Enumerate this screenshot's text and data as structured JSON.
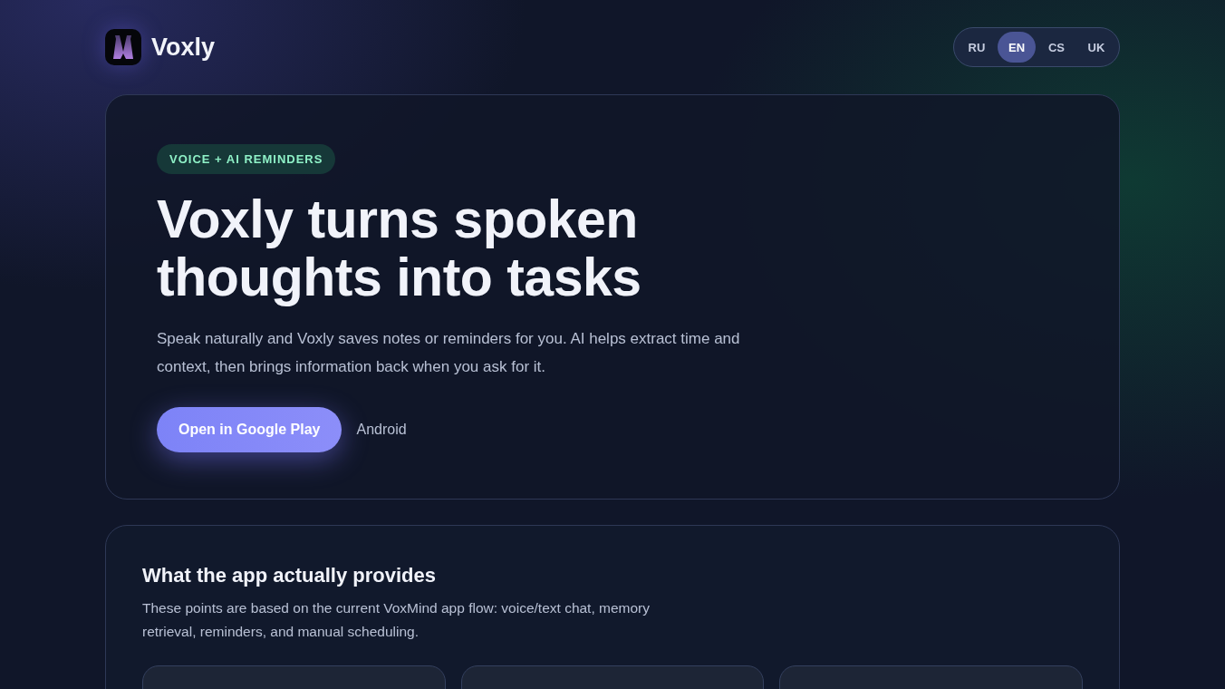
{
  "brand": {
    "name": "Voxly"
  },
  "languages": [
    {
      "label": "RU",
      "selected": false
    },
    {
      "label": "EN",
      "selected": true
    },
    {
      "label": "CS",
      "selected": false
    },
    {
      "label": "UK",
      "selected": false
    }
  ],
  "hero": {
    "badge": "VOICE + AI REMINDERS",
    "title": "Voxly turns spoken thoughts into tasks",
    "description": "Speak naturally and Voxly saves notes or reminders for you. AI helps extract time and context, then brings information back when you ask for it.",
    "button": "Open in Google Play",
    "platform": "Android"
  },
  "features": {
    "title": "What the app actually provides",
    "description": "These points are based on the current VoxMind app flow: voice/text chat, memory retrieval, reminders, and manual scheduling."
  }
}
